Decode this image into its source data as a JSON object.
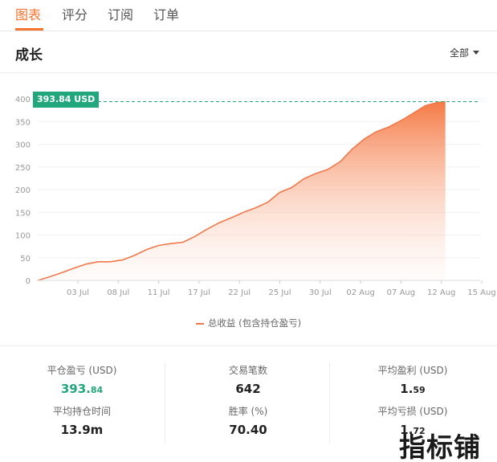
{
  "tabs": [
    {
      "label": "图表",
      "active": true
    },
    {
      "label": "评分",
      "active": false
    },
    {
      "label": "订阅",
      "active": false
    },
    {
      "label": "订单",
      "active": false
    }
  ],
  "section": {
    "title": "成长",
    "range_label": "全部"
  },
  "current_value_tag": "393.84 USD",
  "legend_label": "总收益 (包含持仓盈亏)",
  "colors": {
    "accent": "#f5742f",
    "line": "#f0784a",
    "positive": "#22a67b"
  },
  "chart_data": {
    "type": "area",
    "title": "",
    "xlabel": "",
    "ylabel": "",
    "ylim": [
      0,
      400
    ],
    "yticks": [
      0,
      50,
      100,
      150,
      200,
      250,
      300,
      350,
      400
    ],
    "xticks": [
      "03 Jul",
      "08 Jul",
      "11 Jul",
      "17 Jul",
      "22 Jul",
      "25 Jul",
      "30 Jul",
      "02 Aug",
      "07 Aug",
      "12 Aug",
      "15 Aug"
    ],
    "reference_value": 393.84,
    "series": [
      {
        "name": "总收益 (包含持仓盈亏)",
        "points": [
          [
            0,
            0
          ],
          [
            0.3,
            8
          ],
          [
            0.6,
            17
          ],
          [
            0.9,
            27
          ],
          [
            1.2,
            36
          ],
          [
            1.5,
            41
          ],
          [
            1.8,
            41
          ],
          [
            2.1,
            45
          ],
          [
            2.4,
            55
          ],
          [
            2.7,
            68
          ],
          [
            3.0,
            77
          ],
          [
            3.3,
            81
          ],
          [
            3.6,
            84
          ],
          [
            3.9,
            97
          ],
          [
            4.2,
            113
          ],
          [
            4.5,
            127
          ],
          [
            4.8,
            138
          ],
          [
            5.1,
            150
          ],
          [
            5.4,
            160
          ],
          [
            5.7,
            172
          ],
          [
            6.0,
            194
          ],
          [
            6.3,
            205
          ],
          [
            6.6,
            224
          ],
          [
            6.9,
            236
          ],
          [
            7.2,
            245
          ],
          [
            7.5,
            262
          ],
          [
            7.8,
            290
          ],
          [
            8.1,
            312
          ],
          [
            8.4,
            328
          ],
          [
            8.7,
            338
          ],
          [
            9.0,
            352
          ],
          [
            9.3,
            368
          ],
          [
            9.6,
            385
          ],
          [
            9.9,
            392
          ],
          [
            10.1,
            393.84
          ]
        ]
      }
    ]
  },
  "stats": [
    {
      "label": "平仓盈亏 (USD)",
      "value_main": "393.",
      "value_small": "84",
      "highlight": true
    },
    {
      "label": "交易笔数",
      "value_main": "642",
      "value_small": "",
      "highlight": false
    },
    {
      "label": "平均盈利 (USD)",
      "value_main": "1.",
      "value_small": "59",
      "highlight": false
    },
    {
      "label": "平均持仓时间",
      "value_main": "13.9m",
      "value_small": "",
      "highlight": false
    },
    {
      "label": "胜率 (%)",
      "value_main": "70.40",
      "value_small": "",
      "highlight": false
    },
    {
      "label": "平均亏损 (USD)",
      "value_main": "1.",
      "value_small": "72",
      "highlight": false
    }
  ],
  "watermark": "指标铺"
}
